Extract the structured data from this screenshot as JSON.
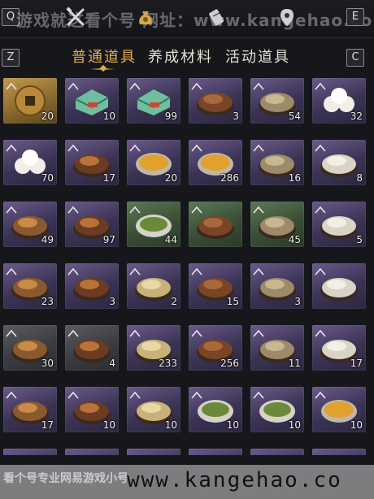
{
  "topbar": {
    "key_q": "Q",
    "key_e": "E",
    "watermark": "游戏就这看个号 网址：www.kangehao.com",
    "icons": [
      "crossed-tools-icon",
      "money-bag-icon",
      "scroll-icon",
      "location-pin-icon"
    ]
  },
  "tabs": {
    "key_z": "Z",
    "key_c": "C",
    "items": [
      {
        "label": "普通道具",
        "active": true
      },
      {
        "label": "养成材料",
        "active": false
      },
      {
        "label": "活动道具",
        "active": false
      }
    ]
  },
  "inventory": {
    "rows": [
      [
        {
          "qty": "20",
          "rarity": "gold",
          "icon": "coin-icon"
        },
        {
          "qty": "10",
          "rarity": "purple",
          "icon": "jade-cake-icon"
        },
        {
          "qty": "99",
          "rarity": "purple",
          "icon": "jade-cake-icon"
        },
        {
          "qty": "3",
          "rarity": "purple",
          "icon": "braised-dish-icon"
        },
        {
          "qty": "54",
          "rarity": "purple",
          "icon": "clay-pot-icon"
        },
        {
          "qty": "32",
          "rarity": "purple",
          "icon": "steamed-buns-icon"
        }
      ],
      [
        {
          "qty": "70",
          "rarity": "purple",
          "icon": "steamed-buns-icon"
        },
        {
          "qty": "17",
          "rarity": "purple",
          "icon": "fish-soup-icon"
        },
        {
          "qty": "20",
          "rarity": "purple",
          "icon": "egg-soup-icon"
        },
        {
          "qty": "286",
          "rarity": "purple",
          "icon": "egg-soup-icon"
        },
        {
          "qty": "16",
          "rarity": "purple",
          "icon": "stir-fry-icon"
        },
        {
          "qty": "8",
          "rarity": "purple",
          "icon": "grilled-fish-icon"
        }
      ],
      [
        {
          "qty": "49",
          "rarity": "purple",
          "icon": "meat-dish-icon"
        },
        {
          "qty": "97",
          "rarity": "purple",
          "icon": "fried-egg-noodle-icon"
        },
        {
          "qty": "44",
          "rarity": "green",
          "icon": "vegetable-plate-icon"
        },
        {
          "qty": "",
          "rarity": "green",
          "icon": "mushroom-dish-icon"
        },
        {
          "qty": "45",
          "rarity": "green",
          "icon": "clay-pot-soup-icon"
        },
        {
          "qty": "5",
          "rarity": "purple",
          "icon": "hot-pot-icon"
        }
      ],
      [
        {
          "qty": "23",
          "rarity": "purple",
          "icon": "chestnut-plate-icon"
        },
        {
          "qty": "3",
          "rarity": "purple",
          "icon": "braised-pork-icon"
        },
        {
          "qty": "2",
          "rarity": "purple",
          "icon": "clam-dish-icon"
        },
        {
          "qty": "15",
          "rarity": "purple",
          "icon": "roast-meat-icon"
        },
        {
          "qty": "3",
          "rarity": "purple",
          "icon": "meatball-dish-icon"
        },
        {
          "qty": "",
          "rarity": "purple",
          "icon": "pancake-stack-icon"
        }
      ],
      [
        {
          "qty": "30",
          "rarity": "grey",
          "icon": "noodle-plate-icon"
        },
        {
          "qty": "4",
          "rarity": "grey",
          "icon": "noodle-plate-icon"
        },
        {
          "qty": "233",
          "rarity": "purple",
          "icon": "fish-stew-icon"
        },
        {
          "qty": "256",
          "rarity": "purple",
          "icon": "mushroom-pile-icon"
        },
        {
          "qty": "11",
          "rarity": "purple",
          "icon": "sliced-meat-icon"
        },
        {
          "qty": "17",
          "rarity": "purple",
          "icon": "braised-slices-icon"
        }
      ],
      [
        {
          "qty": "17",
          "rarity": "purple",
          "icon": "tofu-plate-icon"
        },
        {
          "qty": "10",
          "rarity": "purple",
          "icon": "spicy-soup-icon"
        },
        {
          "qty": "10",
          "rarity": "purple",
          "icon": "dark-stew-icon"
        },
        {
          "qty": "10",
          "rarity": "purple",
          "icon": "green-soup-icon"
        },
        {
          "qty": "10",
          "rarity": "purple",
          "icon": "green-soup-icon"
        },
        {
          "qty": "10",
          "rarity": "purple",
          "icon": "golden-soup-icon"
        }
      ]
    ]
  },
  "footer_watermark": {
    "small": "看个号专业网易游戏小号",
    "url": "www.kangehao.co"
  },
  "colors": {
    "tab_active": "#e2a94d",
    "background": "#15171b"
  }
}
